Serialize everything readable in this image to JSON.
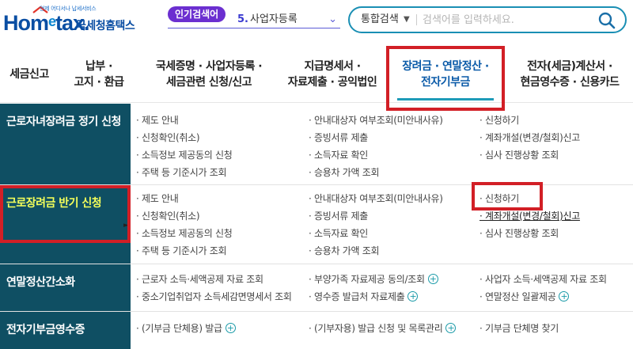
{
  "header": {
    "logo_tagline": "언제 어디서나 납세서비스",
    "logo_word": "Hometax.",
    "logo_kr": "국세청홈택스",
    "popular": {
      "badge": "인기검색어",
      "rank": "5.",
      "term": "사업자등록"
    },
    "search": {
      "category": "통합검색",
      "placeholder": "검색어를 입력하세요."
    }
  },
  "menu": [
    {
      "label": "세금신고"
    },
    {
      "label": "납부 ·\n고지 · 환급"
    },
    {
      "label": "국세증명 · 사업자등록 ·\n세금관련 신청/신고"
    },
    {
      "label": "지급명세서 ·\n자료제출 · 공익법인"
    },
    {
      "label": "장려금 · 연말정산 ·\n전자기부금"
    },
    {
      "label": "전자(세금)계산서 ·\n현금영수증 · 신용카드"
    }
  ],
  "sections": [
    {
      "title": "근로자녀장려금 정기 신청",
      "col1": [
        "· 제도 안내",
        "· 신청확인(취소)",
        "· 소득정보 제공동의 신청",
        "· 주택 등 기준시가 조회"
      ],
      "col2": [
        "· 안내대상자 여부조회(미안내사유)",
        "· 증빙서류 제출",
        "· 소득자료 확인",
        "· 승용차 가액 조회"
      ],
      "col3": [
        "· 신청하기",
        "· 계좌개설(변경/철회)신고",
        "· 심사 진행상황 조회"
      ]
    },
    {
      "title": "근로장려금 반기 신청",
      "col1": [
        "· 제도 안내",
        "· 신청확인(취소)",
        "· 소득정보 제공동의 신청",
        "· 주택 등 기준시가 조회"
      ],
      "col2": [
        "· 안내대상자 여부조회(미안내사유)",
        "· 증빙서류 제출",
        "· 소득자료 확인",
        "· 승용차 가액 조회"
      ],
      "col3": [
        "· 신청하기",
        "· 계좌개설(변경/철회)신고",
        "· 심사 진행상황 조회"
      ]
    },
    {
      "title": "연말정산간소화",
      "col1": [
        "· 근로자 소득·세액공제 자료 조회",
        "· 중소기업취업자 소득세감면명세서 조회"
      ],
      "col2": [
        "· 부양가족 자료제공 동의/조회",
        "· 영수증 발급처 자료제출"
      ],
      "col3": [
        "· 사업자 소득·세액공제 자료 조회",
        "· 연말정산 일괄제공"
      ]
    },
    {
      "title": "전자기부금영수증",
      "col1": [
        "· (기부금 단체용) 발급"
      ],
      "col2": [
        "· (기부자용) 발급 신청 및 목록관리"
      ],
      "col3": [
        "· 기부금 단체명 찾기"
      ]
    }
  ],
  "colors": {
    "brand": "#0a4ea3",
    "sidebar": "#0f4f63",
    "highlight": "#d21f26",
    "accent": "#1e9bb8",
    "badge": "#6b2fd0"
  }
}
